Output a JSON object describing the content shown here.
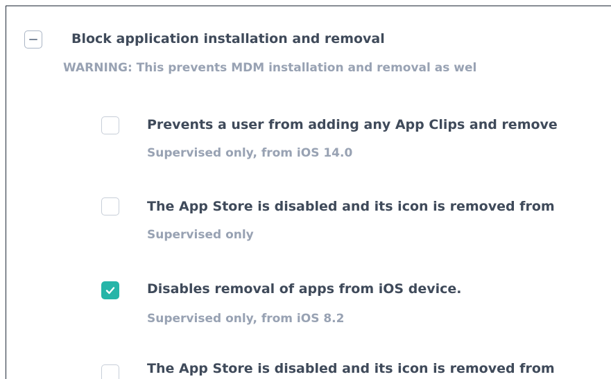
{
  "parent": {
    "title": "Block application installation and removal",
    "warning": "WARNING: This prevents MDM installation and removal as wel",
    "state": "indeterminate"
  },
  "options": [
    {
      "title": "Prevents a user from adding any App Clips and remove",
      "subtitle": "Supervised only, from iOS 14.0",
      "checked": false
    },
    {
      "title": "The App Store is disabled and its icon is removed from",
      "subtitle": "Supervised only",
      "checked": false
    },
    {
      "title": "Disables removal of apps from iOS device.",
      "subtitle": "Supervised only, from iOS 8.2",
      "checked": true
    },
    {
      "title": "The App Store is disabled and its icon is removed from",
      "subtitle": "",
      "checked": false
    }
  ],
  "colors": {
    "accent": "#26b5a8",
    "title_text": "#3f4a5a",
    "subtitle_text": "#98a2b3"
  }
}
